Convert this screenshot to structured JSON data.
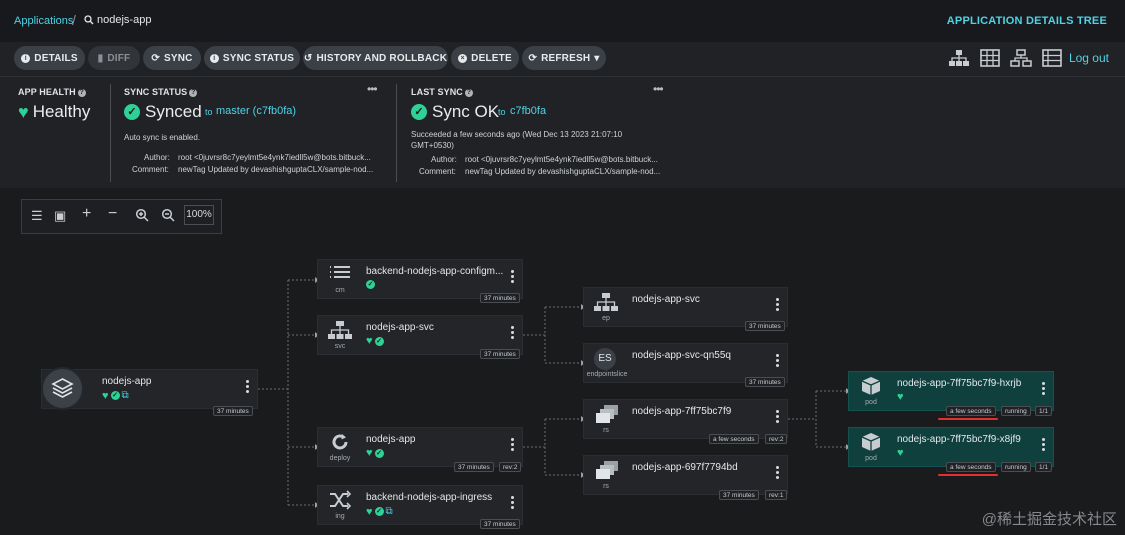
{
  "breadcrumb": {
    "applications": "Applications",
    "current": "nodejs-app"
  },
  "page_title": "APPLICATION DETAILS TREE",
  "toolbar": {
    "details": "DETAILS",
    "diff": "DIFF",
    "sync": "SYNC",
    "sync_status": "SYNC STATUS",
    "history": "HISTORY AND ROLLBACK",
    "delete": "DELETE",
    "refresh": "REFRESH"
  },
  "view_icons": [
    "tree-view-icon",
    "pods-view-icon",
    "network-view-icon",
    "list-view-icon"
  ],
  "logout": "Log out",
  "app_health": {
    "title": "APP HEALTH",
    "value": "Healthy"
  },
  "sync_status": {
    "title": "SYNC STATUS",
    "value": "Synced",
    "to_prefix": "to",
    "to_link": "master (c7fb0fa)",
    "auto_sync": "Auto sync is enabled.",
    "author_label": "Author:",
    "author": "root <0juvrsr8c7yeylmt5e4ynk7iedll5w@bots.bitbuck...",
    "comment_label": "Comment:",
    "comment": "newTag Updated by devashishguptaCLX/sample-nod..."
  },
  "last_sync": {
    "title": "LAST SYNC",
    "value": "Sync OK",
    "to_prefix": "to",
    "to_link": "c7fb0fa",
    "succeeded_line1": "Succeeded a few seconds ago (Wed Dec 13 2023 21:07:10",
    "succeeded_line2": "GMT+0530)",
    "author_label": "Author:",
    "author": "root <0juvrsr8c7yeylmt5e4ynk7iedll5w@bots.bitbuck...",
    "comment_label": "Comment:",
    "comment": "newTag Updated by devashishguptaCLX/sample-nod..."
  },
  "zoom": {
    "value": "100%"
  },
  "nodes": {
    "root": {
      "name": "nodejs-app",
      "age": "37 minutes"
    },
    "cm": {
      "name": "backend-nodejs-app-configm...",
      "kind": "cm",
      "age": "37 minutes"
    },
    "svc": {
      "name": "nodejs-app-svc",
      "kind": "svc",
      "age": "37 minutes"
    },
    "deploy": {
      "name": "nodejs-app",
      "kind": "deploy",
      "age": "37 minutes",
      "rev": "rev:2"
    },
    "ing": {
      "name": "backend-nodejs-app-ingress",
      "kind": "ing",
      "age": "37 minutes"
    },
    "ep": {
      "name": "nodejs-app-svc",
      "kind": "ep",
      "age": "37 minutes"
    },
    "eps": {
      "name": "nodejs-app-svc-qn55q",
      "kind": "endpointslice",
      "badge": "ES",
      "age": "37 minutes"
    },
    "rs1": {
      "name": "nodejs-app-7ff75bc7f9",
      "kind": "rs",
      "age": "a few seconds",
      "rev": "rev:2"
    },
    "rs2": {
      "name": "nodejs-app-697f7794bd",
      "kind": "rs",
      "age": "37 minutes",
      "rev": "rev:1"
    },
    "pod1": {
      "name": "nodejs-app-7ff75bc7f9-hxrjb",
      "kind": "pod",
      "age": "a few seconds",
      "state": "running",
      "ready": "1/1"
    },
    "pod2": {
      "name": "nodejs-app-7ff75bc7f9-x8jf9",
      "kind": "pod",
      "age": "a few seconds",
      "state": "running",
      "ready": "1/1"
    }
  },
  "watermark": "@稀土掘金技术社区",
  "colors": {
    "accent": "#4fd2e7",
    "healthy": "#2ed196",
    "pod_bg": "#10403e"
  }
}
